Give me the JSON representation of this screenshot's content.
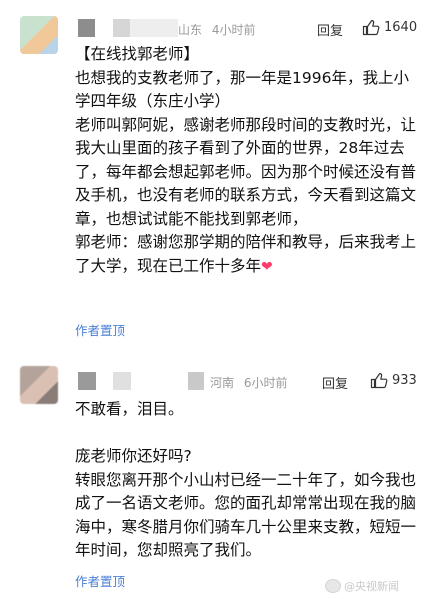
{
  "comments": [
    {
      "location": "山东",
      "time": "4小时前",
      "reply_label": "回复",
      "likes": "1640",
      "heading": "【在线找郭老师】",
      "paragraphs": [
        "也想我的支教老师了，那一年是1996年，我上小学四年级（东庄小学）",
        "老师叫郭阿妮，感谢老师那段时间的支教时光，让我大山里面的孩子看到了外面的世界，28年过去了，每年都会想起郭老师。因为那个时候还没有普及手机，也没有老师的联系方式，今天看到这篇文章，也想试试能不能找到郭老师，",
        "郭老师：感谢您那学期的陪伴和教导，后来我考上了大学，现在已工作十多年"
      ],
      "badge": "作者置顶"
    },
    {
      "location": "河南",
      "time": "6小时前",
      "reply_label": "回复",
      "likes": "933",
      "paragraphs": [
        "不敢看，泪目。",
        "庞老师你还好吗?",
        "转眼您离开那个小山村已经一二十年了，如今我也成了一名语文老师。您的面孔却常常出现在我的脑海中，寒冬腊月你们骑车几十公里来支教，短短一年时间，您却照亮了我们。"
      ],
      "badge": "作者置顶"
    }
  ],
  "watermark": "@央视新闻",
  "colors": {
    "accent": "#4a7fd6",
    "heart": "#ff3b6b",
    "meta": "#9a9a9a"
  },
  "icons": [
    "thumbs-up-icon",
    "heart-icon",
    "weibo-logo-icon"
  ]
}
